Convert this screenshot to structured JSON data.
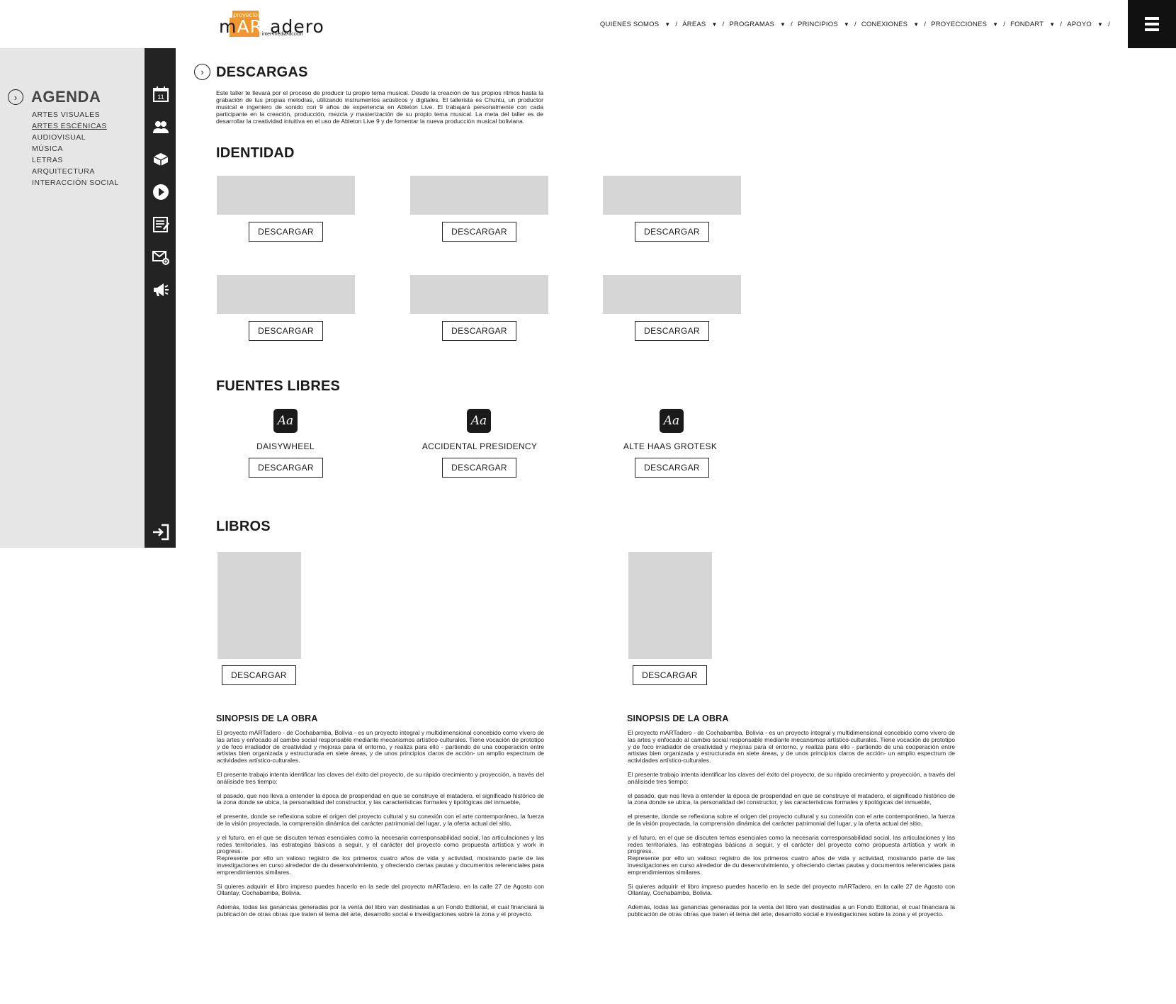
{
  "brand": {
    "top_word": "proyecto",
    "word_m": "m",
    "word_art": "ART",
    "word_rest": "adero",
    "tagline": "inter•media•acción",
    "version": "2.0",
    "accent_color": "#f0962e"
  },
  "topnav": {
    "items": [
      {
        "label": "QUIENES SOMOS",
        "caret": "▼",
        "sep": "/"
      },
      {
        "label": "ÁREAS",
        "caret": "▼",
        "sep": "/"
      },
      {
        "label": "PROGRAMAS",
        "caret": "▼",
        "sep": "/"
      },
      {
        "label": "PRINCIPIOS",
        "caret": "▼",
        "sep": "/"
      },
      {
        "label": "CONEXIONES",
        "caret": "▼",
        "sep": "/"
      },
      {
        "label": "PROYECCIONES",
        "caret": "▼",
        "sep": "/"
      },
      {
        "label": "FONDART",
        "caret": "▼",
        "sep": "/"
      },
      {
        "label": "APOYO",
        "caret": "▼",
        "sep": "/"
      }
    ],
    "menu_icon": "hamburger-icon"
  },
  "sidebar": {
    "arrow": "›",
    "title": "AGENDA",
    "items": [
      {
        "label": "ARTES VISUALES",
        "active": false
      },
      {
        "label": "ARTES ESCÉNICAS",
        "active": true
      },
      {
        "label": "AUDIOVISUAL",
        "active": false
      },
      {
        "label": "MÚSICA",
        "active": false
      },
      {
        "label": "LETRAS",
        "active": false
      },
      {
        "label": "ARQUITECTURA",
        "active": false
      },
      {
        "label": "INTERACCIÓN SOCIAL",
        "active": false
      }
    ],
    "icons": {
      "calendar_day": "11",
      "list": [
        "calendar-icon",
        "people-icon",
        "cube-icon",
        "play-icon",
        "notes-icon",
        "mail-icon",
        "megaphone-icon",
        "login-icon"
      ]
    }
  },
  "main": {
    "arrow": "›",
    "descargas": {
      "title": "DESCARGAS",
      "intro": "Este taller te llevará por el proceso de producir tu propio tema musical. Desde la creación de tus propios ritmos hasta la grabación de tus propias melodías, utilizando instrumentos acústicos y digitales. El tallerista es Chuntu, un productor musical e ingeniero de sonido con 9 años de experiencia en Ableton Live. El trabajará personalmente con cada participante en la creación, producción, mezcla y masterización de su propio tema musical. La meta del taller es de desarrollar la creatividad intuitiva en el uso de Ableton Live 9 y de fomentar la nueva producción musical boliviana."
    },
    "identidad": {
      "title": "IDENTIDAD",
      "button_label": "DESCARGAR",
      "count": 6
    },
    "fuentes": {
      "title": "FUENTES LIBRES",
      "glyph": "Aa",
      "button_label": "DESCARGAR",
      "items": [
        "DAISYWHEEL",
        "ACCIDENTAL PRESIDENCY",
        "ALTE HAAS GROTESK"
      ]
    },
    "libros": {
      "title": "LIBROS",
      "button_label": "DESCARGAR",
      "books": [
        {
          "synopsis_title": "SINOPSIS DE LA OBRA",
          "paragraphs": [
            "El proyecto mARTadero - de Cochabamba, Bolivia - es un proyecto integral y multidimensional concebido como vivero de las artes y enfocado al cambio social responsable mediante mecanismos artístico-culturales. Tiene vocación de prototipo y de foco irradiador de creatividad y mejoras para el entorno, y realiza para ello - partiendo de una cooperación entre artistas bien organizada y estructurada en siete áreas, y de unos principios claros de acción- un amplio espectrum de actividades artístico-culturales.",
            "El presente trabajo intenta identificar las claves del éxito del proyecto, de su rápido crecimiento y proyección, a través del análisisde tres tiempo:",
            "el pasado, que nos lleva a entender la época de prosperidad en que se construye el matadero, el significado histórico de la zona donde se ubica, la personalidad del constructor, y las características formales y tipológicas del inmueble,",
            "el presente, donde se reflexiona sobre el origen del proyecto cultural y su conexión con el arte contemporáneo, la fuerza de la visión proyectada, la comprensión dinámica del carácter patrimonial del lugar, y la oferta actual del sitio,",
            "y el futuro, en el que se discuten temas esenciales como la necesaria corresponsabilidad social, las articulaciones y las redes territoriales, las estrategias básicas a seguir, y el carácter del proyecto como propuesta artística y work in progress.",
            "Represente por ello un valioso registro de los primeros cuatro años de vida y actividad, mostrando parte de las investigaciones en curso alrededor de du desenvolvimiento, y ofreciendo ciertas pautas y documentos referenciales para emprendimientos similares.",
            "Si quieres adquirir el libro impreso puedes hacerlo en la sede del proyecto mARTadero, en la calle 27 de Agosto con Ollantay, Cochabamba, Bolivia.",
            "Además, todas las ganancias generadas por la venta del libro van destinadas a un Fondo Editorial, el cual financiará la publicación de otras obras que traten el tema del arte, desarrollo social e investigaciones sobre la zona y el proyecto."
          ]
        },
        {
          "synopsis_title": "SINOPSIS DE LA OBRA",
          "paragraphs": [
            "El proyecto mARTadero - de Cochabamba, Bolivia - es un proyecto integral y multidimensional concebido como vivero de las artes y enfocado al cambio social responsable mediante mecanismos artístico-culturales. Tiene vocación de prototipo y de foco irradiador de creatividad y mejoras para el entorno, y realiza para ello - partiendo de una cooperación entre artistas bien organizada y estructurada en siete áreas, y de unos principios claros de acción- un amplio espectrum de actividades artístico-culturales.",
            "El presente trabajo intenta identificar las claves del éxito del proyecto, de su rápido crecimiento y proyección, a través del análisisde tres tiempo:",
            "el pasado, que nos lleva a entender la época de prosperidad en que se construye el matadero, el significado histórico de la zona donde se ubica, la personalidad del constructor, y las características formales y tipológicas del inmueble,",
            "el presente, donde se reflexiona sobre el origen del proyecto cultural y su conexión con el arte contemporáneo, la fuerza de la visión proyectada, la comprensión dinámica del carácter patrimonial del lugar, y la oferta actual del sitio,",
            "y el futuro, en el que se discuten temas esenciales como la necesaria corresponsabilidad social, las articulaciones y las redes territoriales, las estrategias básicas a seguir, y el carácter del proyecto como propuesta artística y work in progress.",
            "Represente por ello un valioso registro de los primeros cuatro años de vida y actividad, mostrando parte de las investigaciones en curso alrededor de du desenvolvimiento, y ofreciendo ciertas pautas y documentos referenciales para emprendimientos similares.",
            "Si quieres adquirir el libro impreso puedes hacerlo en la sede del proyecto mARTadero, en la calle 27 de Agosto con Ollantay, Cochabamba, Bolivia.",
            "Además, todas las ganancias generadas por la venta del libro van destinadas a un Fondo Editorial, el cual financiará la publicación de otras obras que traten el tema del arte, desarrollo social e investigaciones sobre la zona y el proyecto."
          ]
        }
      ]
    }
  }
}
